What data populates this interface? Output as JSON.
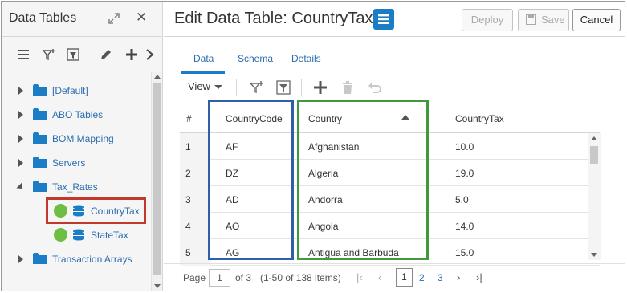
{
  "left_panel": {
    "title": "Data Tables",
    "tree": [
      {
        "label": "[Default]",
        "expanded": false
      },
      {
        "label": "ABO Tables",
        "expanded": false
      },
      {
        "label": "BOM Mapping",
        "expanded": false
      },
      {
        "label": "Servers",
        "expanded": false
      },
      {
        "label": "Tax_Rates",
        "expanded": true,
        "children": [
          {
            "label": "CountryTax",
            "selected": true
          },
          {
            "label": "StateTax",
            "selected": false
          }
        ]
      },
      {
        "label": "Transaction Arrays",
        "expanded": false
      }
    ]
  },
  "main": {
    "title": "Edit Data Table: CountryTax",
    "buttons": {
      "deploy": "Deploy",
      "save": "Save",
      "cancel": "Cancel"
    },
    "tabs": [
      "Data",
      "Schema",
      "Details"
    ],
    "active_tab": "Data",
    "toolbar": {
      "view_label": "View"
    },
    "grid": {
      "columns": [
        "#",
        "CountryCode",
        "Country",
        "CountryTax"
      ],
      "sorted_column": "Country",
      "sort_direction": "ascending",
      "rows": [
        [
          "1",
          "AF",
          "Afghanistan",
          "10.0"
        ],
        [
          "2",
          "DZ",
          "Algeria",
          "19.0"
        ],
        [
          "3",
          "AD",
          "Andorra",
          "5.0"
        ],
        [
          "4",
          "AO",
          "Angola",
          "14.0"
        ],
        [
          "5",
          "AG",
          "Antigua and Barbuda",
          "15.0"
        ]
      ]
    },
    "pager": {
      "page_label": "Page",
      "page_value": "1",
      "of_label": "of 3",
      "items_label": "(1-50 of 138 items)",
      "current_page": "1",
      "pages": [
        "2",
        "3"
      ]
    }
  },
  "colors": {
    "accent": "#1b7dc6",
    "link": "#2a6db0",
    "highlight_red": "#c0392b",
    "highlight_blue": "#2e5fa8",
    "highlight_green": "#3f9a3a",
    "status_green": "#6fbe44"
  }
}
